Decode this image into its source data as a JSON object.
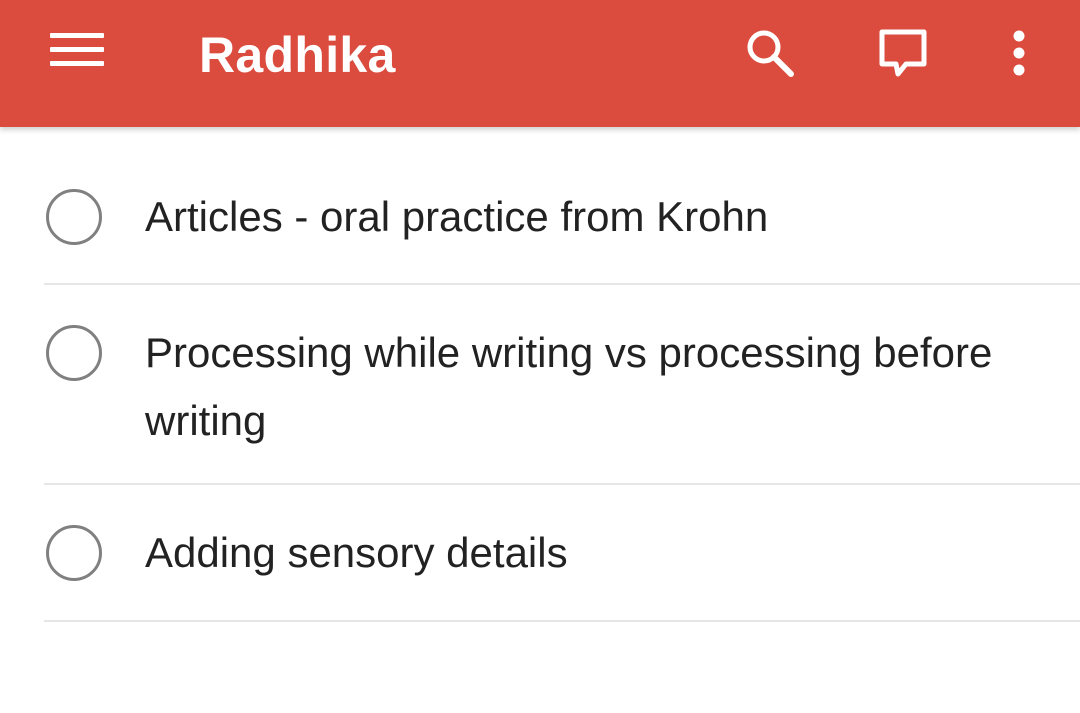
{
  "app": {
    "header_color": "#db4c3f",
    "title": "Radhika"
  },
  "toolbar": {
    "menu_icon": "hamburger-menu-icon",
    "search_icon": "search-icon",
    "comment_icon": "comment-icon",
    "more_icon": "more-vert-icon"
  },
  "tasks": [
    {
      "text": "Articles - oral practice from Krohn",
      "completed": false
    },
    {
      "text": "Processing while writing vs processing before writing",
      "completed": false
    },
    {
      "text": "Adding sensory details",
      "completed": false
    }
  ]
}
